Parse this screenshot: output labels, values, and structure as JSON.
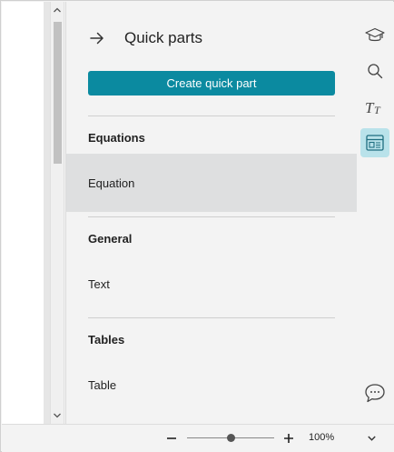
{
  "panel": {
    "title": "Quick parts",
    "create_button_label": "Create quick part",
    "sections": [
      {
        "heading": "Equations",
        "items": [
          "Equation"
        ]
      },
      {
        "heading": "General",
        "items": [
          "Text"
        ]
      },
      {
        "heading": "Tables",
        "items": [
          "Table"
        ]
      }
    ],
    "selected_item": "Equation"
  },
  "rail": {
    "icons": [
      "graduation-cap-icon",
      "search-icon",
      "text-style-icon",
      "quick-parts-icon",
      "comment-icon"
    ],
    "active": "quick-parts-icon"
  },
  "statusbar": {
    "zoom_level": "100%",
    "zoom_fraction": 0.5
  },
  "colors": {
    "accent": "#0b8aa0",
    "active_rail_bg": "#b9e2ea",
    "selected_row_bg": "#dedfe0"
  }
}
